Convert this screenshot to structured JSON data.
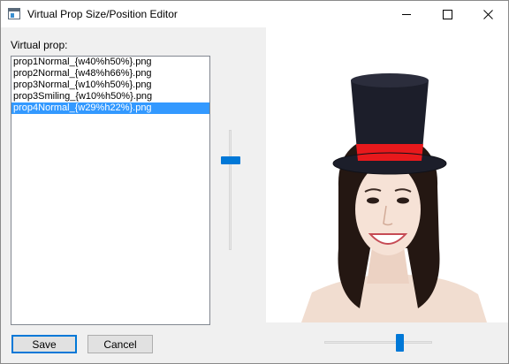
{
  "window": {
    "title": "Virtual Prop Size/Position Editor"
  },
  "left_panel": {
    "label": "Virtual prop:",
    "items": [
      {
        "label": "prop1Normal_{w40%h50%}.png",
        "selected": false
      },
      {
        "label": "prop2Normal_{w48%h66%}.png",
        "selected": false
      },
      {
        "label": "prop3Normal_{w10%h50%}.png",
        "selected": false
      },
      {
        "label": "prop3Smiling_{w10%h50%}.png",
        "selected": false
      },
      {
        "label": "prop4Normal_{w29%h22%}.png",
        "selected": true
      }
    ]
  },
  "vertical_slider": {
    "value_fraction": 0.24
  },
  "horizontal_slider": {
    "value_fraction": 0.72
  },
  "buttons": {
    "save_label": "Save",
    "cancel_label": "Cancel"
  },
  "colors": {
    "accent": "#0078d7",
    "selection": "#3399ff",
    "hat_band": "#e8191c",
    "hat_body": "#1c1e2a"
  }
}
